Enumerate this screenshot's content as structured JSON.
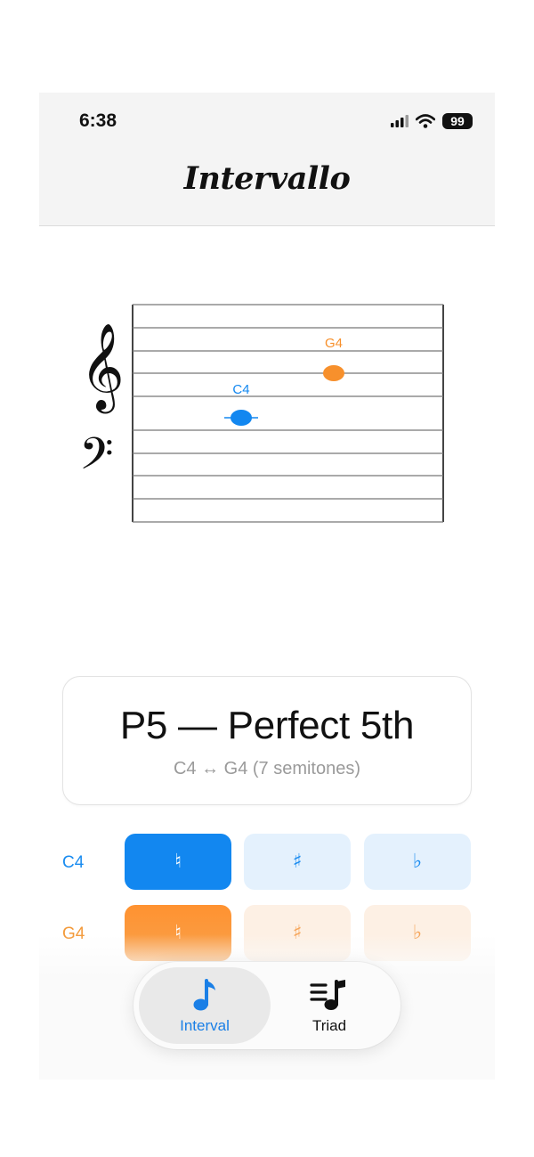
{
  "status_bar": {
    "time": "6:38",
    "battery": "99"
  },
  "app": {
    "title": "Intervallo"
  },
  "staff": {
    "notes": [
      {
        "name": "C4",
        "color": "#1287f0"
      },
      {
        "name": "G4",
        "color": "#f7902c"
      }
    ]
  },
  "interval": {
    "name": "P5 — Perfect 5th",
    "detail": "C4 ↔ G4 (7 semitones)"
  },
  "accidental_rows": [
    {
      "note": "C4",
      "color": "#1287f0",
      "buttons": [
        "♮",
        "♯",
        "♭"
      ],
      "selected": "♮"
    },
    {
      "note": "G4",
      "color": "#f7902c",
      "buttons": [
        "♮",
        "♯",
        "♭"
      ],
      "selected": "♮"
    }
  ],
  "tabs": [
    {
      "label": "Interval",
      "icon": "music-note-icon",
      "active": true
    },
    {
      "label": "Triad",
      "icon": "music-list-icon",
      "active": false
    }
  ]
}
